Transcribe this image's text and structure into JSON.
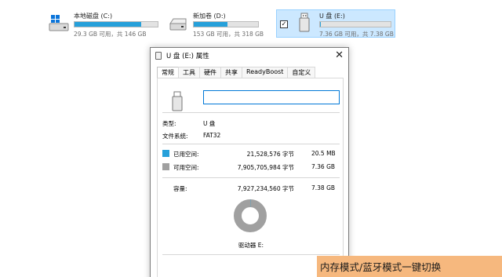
{
  "drives": {
    "c": {
      "name": "本地磁盘 (C:)",
      "size_text": "29.3 GB 可用，共 146 GB",
      "used_fraction": 0.8,
      "icon": "windows-drive-icon"
    },
    "d": {
      "name": "新加卷 (D:)",
      "size_text": "153 GB 可用，共 318 GB",
      "used_fraction": 0.52,
      "icon": "hard-drive-icon"
    },
    "e": {
      "name": "U 盘 (E:)",
      "size_text": "7.36 GB 可用，共 7.38 GB",
      "used_fraction": 0.003,
      "icon": "usb-drive-icon",
      "checkbox": "✓"
    }
  },
  "window": {
    "title": "U 盘 (E:) 属性",
    "close": "✕",
    "tabs": [
      "常规",
      "工具",
      "硬件",
      "共享",
      "ReadyBoost",
      "自定义"
    ],
    "active_tab": 0,
    "name_input_value": "",
    "type_label": "类型:",
    "type_value": "U 盘",
    "fs_label": "文件系统:",
    "fs_value": "FAT32",
    "used_label": "已用空间:",
    "used_bytes": "21,528,576 字节",
    "used_human": "20.5 MB",
    "free_label": "可用空间:",
    "free_bytes": "7,905,705,984 字节",
    "free_human": "7.36 GB",
    "capacity_label": "容量:",
    "capacity_bytes": "7,927,234,560 字节",
    "capacity_human": "7.38 GB",
    "drive_label": "驱动器 E:",
    "used_fraction": 0.0027
  },
  "caption": {
    "line1": "内存模式/蓝牙模式一键切换"
  },
  "colors": {
    "accent": "#26a0da",
    "free": "#a0a0a0",
    "selection": "#cce8ff",
    "caption_bg": "#f6b87e"
  }
}
